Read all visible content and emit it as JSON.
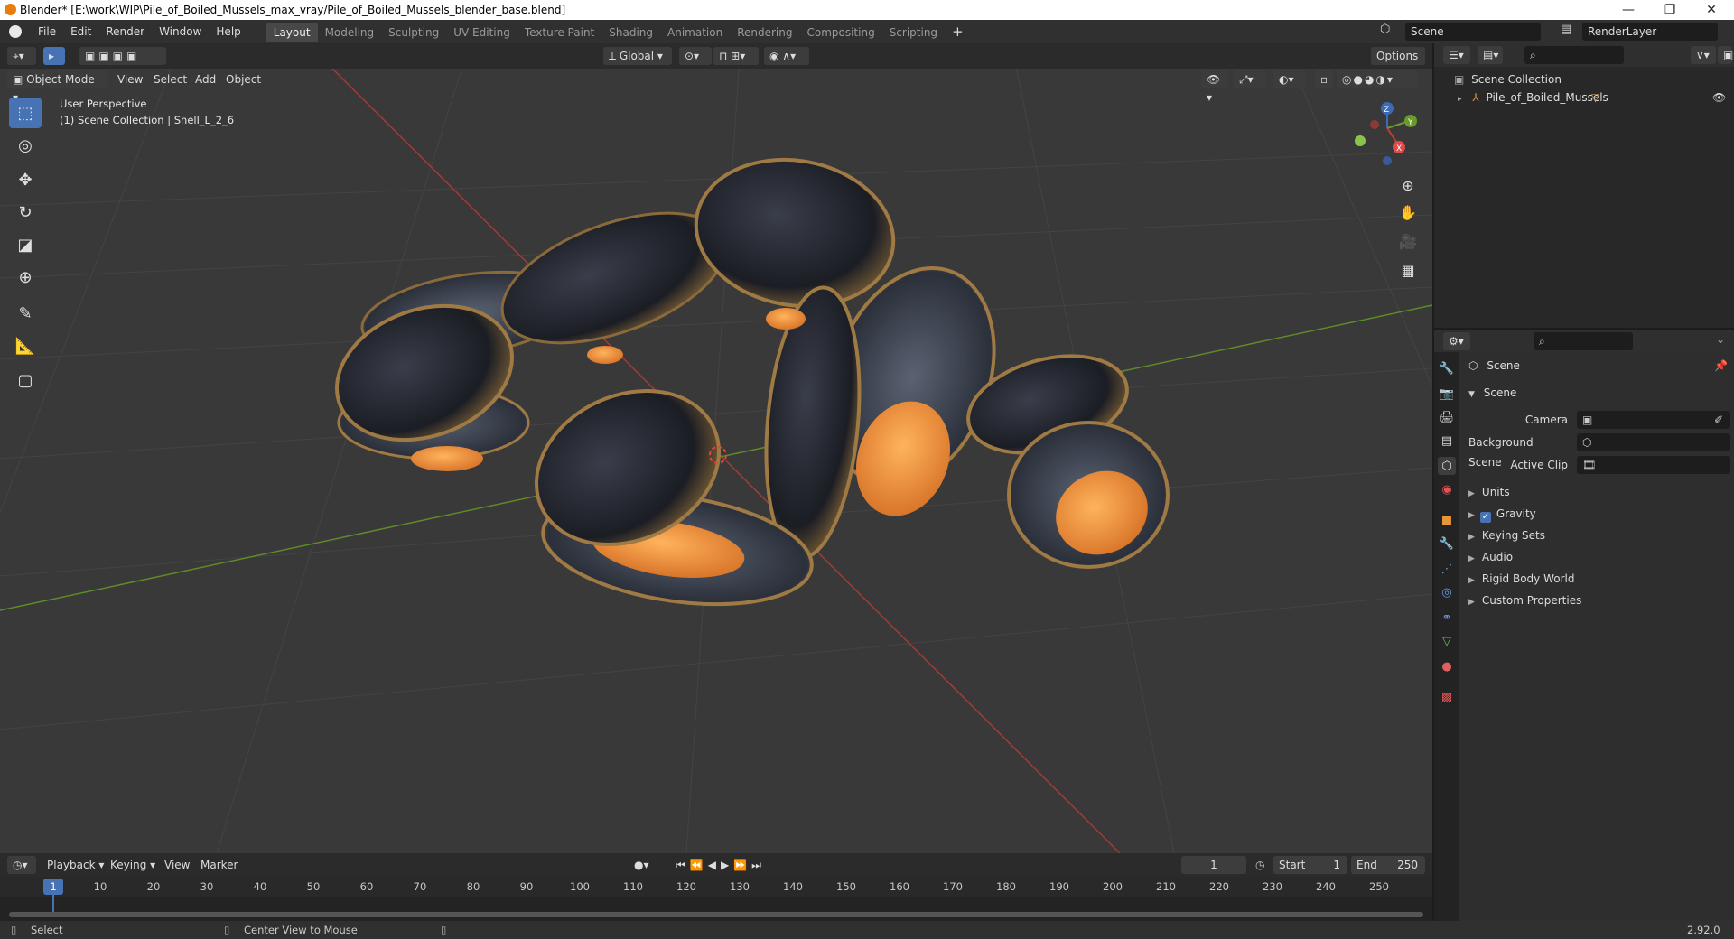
{
  "window": {
    "title": "Blender* [E:\\work\\WIP\\Pile_of_Boiled_Mussels_max_vray/Pile_of_Boiled_Mussels_blender_base.blend]",
    "controls": [
      "—",
      "❐",
      "✕"
    ]
  },
  "menu": [
    "File",
    "Edit",
    "Render",
    "Window",
    "Help"
  ],
  "workspaces": [
    {
      "label": "Layout",
      "active": true
    },
    {
      "label": "Modeling",
      "active": false
    },
    {
      "label": "Sculpting",
      "active": false
    },
    {
      "label": "UV Editing",
      "active": false
    },
    {
      "label": "Texture Paint",
      "active": false
    },
    {
      "label": "Shading",
      "active": false
    },
    {
      "label": "Animation",
      "active": false
    },
    {
      "label": "Rendering",
      "active": false
    },
    {
      "label": "Compositing",
      "active": false
    },
    {
      "label": "Scripting",
      "active": false
    }
  ],
  "scene_selector": {
    "value": "Scene"
  },
  "render_layer": {
    "value": "RenderLayer"
  },
  "viewport": {
    "mode": "Object Mode",
    "menus": [
      "View",
      "Select",
      "Add",
      "Object"
    ],
    "orientation": "Global",
    "options_label": "Options",
    "overlay_line1": "User Perspective",
    "overlay_line2": "(1) Scene Collection | Shell_L_2_6",
    "gizmo_axes": {
      "x": "X",
      "y": "Y",
      "z": "Z"
    },
    "tools": [
      "select-box-icon",
      "cursor-icon",
      "move-icon",
      "rotate-icon",
      "scale-icon",
      "transform-icon",
      "annotate-icon",
      "measure-icon",
      "add-cube-icon"
    ]
  },
  "outliner": {
    "root": "Scene Collection",
    "items": [
      {
        "label": "Pile_of_Boiled_Mussels"
      }
    ]
  },
  "properties": {
    "context": "Scene",
    "panel": "Scene",
    "fields": [
      {
        "label": "Camera"
      },
      {
        "label": "Background Scene"
      },
      {
        "label": "Active Clip"
      }
    ],
    "sections": [
      {
        "label": "Units",
        "checkbox": false
      },
      {
        "label": "Gravity",
        "checkbox": true
      },
      {
        "label": "Keying Sets",
        "checkbox": false
      },
      {
        "label": "Audio",
        "checkbox": false
      },
      {
        "label": "Rigid Body World",
        "checkbox": false
      },
      {
        "label": "Custom Properties",
        "checkbox": false
      }
    ]
  },
  "timeline": {
    "menus": [
      "Playback",
      "Keying",
      "View",
      "Marker"
    ],
    "current_frame": "1",
    "start_label": "Start",
    "start": "1",
    "end_label": "End",
    "end": "250",
    "ticks": [
      "1",
      "10",
      "20",
      "30",
      "40",
      "50",
      "60",
      "70",
      "80",
      "90",
      "100",
      "110",
      "120",
      "130",
      "140",
      "150",
      "160",
      "170",
      "180",
      "190",
      "200",
      "210",
      "220",
      "230",
      "240",
      "250"
    ]
  },
  "status": {
    "left": "Select",
    "middle": "Center View to Mouse",
    "version": "2.92.0"
  },
  "colors": {
    "accent": "#4772b3",
    "x_axis": "#b23a3a",
    "y_axis": "#6a9a2a"
  }
}
